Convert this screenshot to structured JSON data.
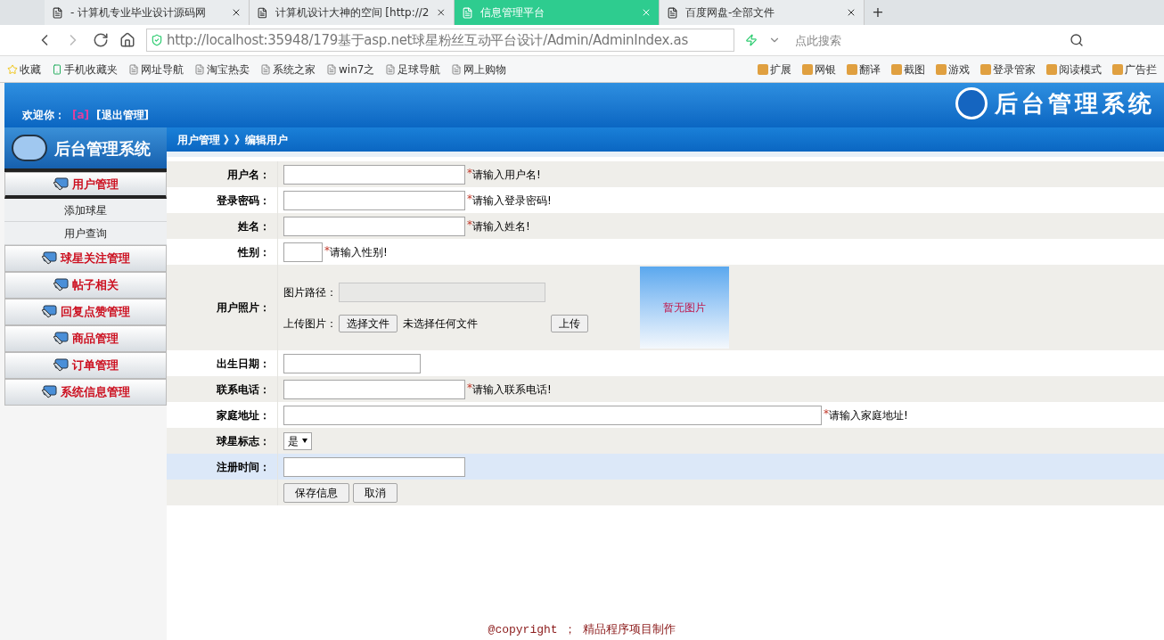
{
  "browser": {
    "tabs": [
      {
        "title": "- 计算机专业毕业设计源码网",
        "selected": false
      },
      {
        "title": "计算机设计大神的空间 [http://2",
        "selected": false
      },
      {
        "title": "信息管理平台",
        "selected": true
      },
      {
        "title": "百度网盘-全部文件",
        "selected": false
      }
    ],
    "new_tab": "+",
    "address": "http://localhost:35948/179基于asp.net球星粉丝互动平台设计/Admin/AdminIndex.as",
    "search": {
      "placeholder": "点此搜索"
    },
    "bookmarks": [
      "收藏",
      "手机收藏夹",
      "网址导航",
      "淘宝热卖",
      "系统之家",
      "win7之",
      "足球导航",
      "网上购物"
    ],
    "tools": [
      "扩展",
      "网银",
      "翻译",
      "截图",
      "游戏",
      "登录管家",
      "阅读模式",
      "广告拦"
    ]
  },
  "header": {
    "welcome": "欢迎你：",
    "username": "[a]",
    "logout": "[退出管理]",
    "system_title": "后台管理系统"
  },
  "sidebar": {
    "title": "后台管理系统",
    "menu": [
      {
        "label": "用户管理",
        "expanded": true,
        "children": [
          "添加球星",
          "用户查询"
        ]
      },
      {
        "label": "球星关注管理",
        "expanded": false
      },
      {
        "label": "帖子相关",
        "expanded": false
      },
      {
        "label": "回复点赞管理",
        "expanded": false
      },
      {
        "label": "商品管理",
        "expanded": false
      },
      {
        "label": "订单管理",
        "expanded": false
      },
      {
        "label": "系统信息管理",
        "expanded": false
      }
    ]
  },
  "breadcrumb": "用户管理 》》编辑用户",
  "form": {
    "rows": [
      {
        "kind": "text",
        "label": "用户名：",
        "mark": "*",
        "hint": "请输入用户名!",
        "highlighted": false
      },
      {
        "kind": "text",
        "label": "登录密码：",
        "mark": "*",
        "hint": "请输入登录密码!",
        "highlighted": false
      },
      {
        "kind": "text",
        "label": "姓名：",
        "mark": "*",
        "hint": "请输入姓名!",
        "highlighted": false
      },
      {
        "kind": "short",
        "label": "性别：",
        "mark": "*",
        "hint": "请输入性别!",
        "highlighted": false
      },
      {
        "kind": "photo",
        "label": "用户照片：",
        "path_label": "图片路径：",
        "upload_label": "上传图片：",
        "choose_button": "选择文件",
        "no_file": "未选择任何文件",
        "upload_button": "上传",
        "preview": "暂无图片",
        "highlighted": false
      },
      {
        "kind": "date",
        "label": "出生日期：",
        "highlighted": false
      },
      {
        "kind": "text",
        "label": "联系电话：",
        "mark": "*",
        "hint": "请输入联系电话!",
        "highlighted": false
      },
      {
        "kind": "wide",
        "label": "家庭地址：",
        "mark": "*",
        "hint": "请输入家庭地址!",
        "highlighted": false
      },
      {
        "kind": "select",
        "label": "球星标志：",
        "value": "是",
        "highlighted": false
      },
      {
        "kind": "text",
        "label": "注册时间：",
        "highlighted": true
      },
      {
        "kind": "buttons",
        "buttons": [
          "保存信息",
          "取消"
        ],
        "highlighted": false
      }
    ]
  },
  "footer": {
    "copyright": "@copyright ；",
    "maker": "精品程序项目制作"
  }
}
